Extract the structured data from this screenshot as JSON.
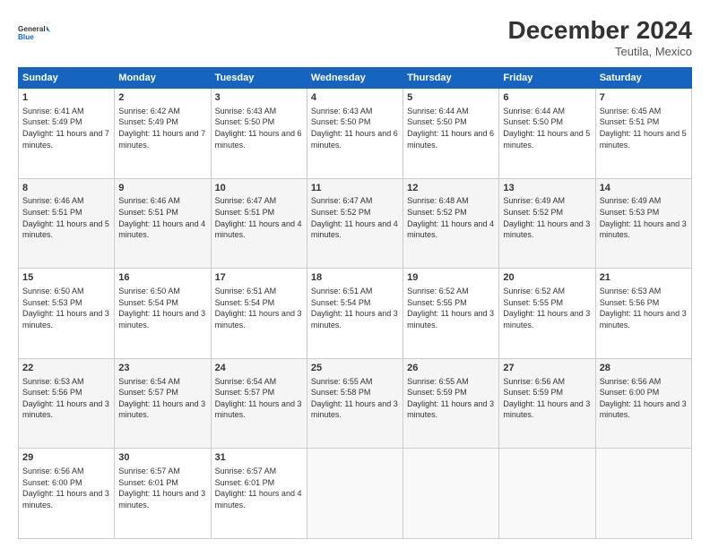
{
  "logo": {
    "line1": "General",
    "line2": "Blue"
  },
  "title": "December 2024",
  "subtitle": "Teutila, Mexico",
  "days_of_week": [
    "Sunday",
    "Monday",
    "Tuesday",
    "Wednesday",
    "Thursday",
    "Friday",
    "Saturday"
  ],
  "weeks": [
    [
      {
        "day": "1",
        "info": "Sunrise: 6:41 AM\nSunset: 5:49 PM\nDaylight: 11 hours and 7 minutes."
      },
      {
        "day": "2",
        "info": "Sunrise: 6:42 AM\nSunset: 5:49 PM\nDaylight: 11 hours and 7 minutes."
      },
      {
        "day": "3",
        "info": "Sunrise: 6:43 AM\nSunset: 5:50 PM\nDaylight: 11 hours and 6 minutes."
      },
      {
        "day": "4",
        "info": "Sunrise: 6:43 AM\nSunset: 5:50 PM\nDaylight: 11 hours and 6 minutes."
      },
      {
        "day": "5",
        "info": "Sunrise: 6:44 AM\nSunset: 5:50 PM\nDaylight: 11 hours and 6 minutes."
      },
      {
        "day": "6",
        "info": "Sunrise: 6:44 AM\nSunset: 5:50 PM\nDaylight: 11 hours and 5 minutes."
      },
      {
        "day": "7",
        "info": "Sunrise: 6:45 AM\nSunset: 5:51 PM\nDaylight: 11 hours and 5 minutes."
      }
    ],
    [
      {
        "day": "8",
        "info": "Sunrise: 6:46 AM\nSunset: 5:51 PM\nDaylight: 11 hours and 5 minutes."
      },
      {
        "day": "9",
        "info": "Sunrise: 6:46 AM\nSunset: 5:51 PM\nDaylight: 11 hours and 4 minutes."
      },
      {
        "day": "10",
        "info": "Sunrise: 6:47 AM\nSunset: 5:51 PM\nDaylight: 11 hours and 4 minutes."
      },
      {
        "day": "11",
        "info": "Sunrise: 6:47 AM\nSunset: 5:52 PM\nDaylight: 11 hours and 4 minutes."
      },
      {
        "day": "12",
        "info": "Sunrise: 6:48 AM\nSunset: 5:52 PM\nDaylight: 11 hours and 4 minutes."
      },
      {
        "day": "13",
        "info": "Sunrise: 6:49 AM\nSunset: 5:52 PM\nDaylight: 11 hours and 3 minutes."
      },
      {
        "day": "14",
        "info": "Sunrise: 6:49 AM\nSunset: 5:53 PM\nDaylight: 11 hours and 3 minutes."
      }
    ],
    [
      {
        "day": "15",
        "info": "Sunrise: 6:50 AM\nSunset: 5:53 PM\nDaylight: 11 hours and 3 minutes."
      },
      {
        "day": "16",
        "info": "Sunrise: 6:50 AM\nSunset: 5:54 PM\nDaylight: 11 hours and 3 minutes."
      },
      {
        "day": "17",
        "info": "Sunrise: 6:51 AM\nSunset: 5:54 PM\nDaylight: 11 hours and 3 minutes."
      },
      {
        "day": "18",
        "info": "Sunrise: 6:51 AM\nSunset: 5:54 PM\nDaylight: 11 hours and 3 minutes."
      },
      {
        "day": "19",
        "info": "Sunrise: 6:52 AM\nSunset: 5:55 PM\nDaylight: 11 hours and 3 minutes."
      },
      {
        "day": "20",
        "info": "Sunrise: 6:52 AM\nSunset: 5:55 PM\nDaylight: 11 hours and 3 minutes."
      },
      {
        "day": "21",
        "info": "Sunrise: 6:53 AM\nSunset: 5:56 PM\nDaylight: 11 hours and 3 minutes."
      }
    ],
    [
      {
        "day": "22",
        "info": "Sunrise: 6:53 AM\nSunset: 5:56 PM\nDaylight: 11 hours and 3 minutes."
      },
      {
        "day": "23",
        "info": "Sunrise: 6:54 AM\nSunset: 5:57 PM\nDaylight: 11 hours and 3 minutes."
      },
      {
        "day": "24",
        "info": "Sunrise: 6:54 AM\nSunset: 5:57 PM\nDaylight: 11 hours and 3 minutes."
      },
      {
        "day": "25",
        "info": "Sunrise: 6:55 AM\nSunset: 5:58 PM\nDaylight: 11 hours and 3 minutes."
      },
      {
        "day": "26",
        "info": "Sunrise: 6:55 AM\nSunset: 5:59 PM\nDaylight: 11 hours and 3 minutes."
      },
      {
        "day": "27",
        "info": "Sunrise: 6:56 AM\nSunset: 5:59 PM\nDaylight: 11 hours and 3 minutes."
      },
      {
        "day": "28",
        "info": "Sunrise: 6:56 AM\nSunset: 6:00 PM\nDaylight: 11 hours and 3 minutes."
      }
    ],
    [
      {
        "day": "29",
        "info": "Sunrise: 6:56 AM\nSunset: 6:00 PM\nDaylight: 11 hours and 3 minutes."
      },
      {
        "day": "30",
        "info": "Sunrise: 6:57 AM\nSunset: 6:01 PM\nDaylight: 11 hours and 3 minutes."
      },
      {
        "day": "31",
        "info": "Sunrise: 6:57 AM\nSunset: 6:01 PM\nDaylight: 11 hours and 4 minutes."
      },
      {
        "day": "",
        "info": ""
      },
      {
        "day": "",
        "info": ""
      },
      {
        "day": "",
        "info": ""
      },
      {
        "day": "",
        "info": ""
      }
    ]
  ]
}
